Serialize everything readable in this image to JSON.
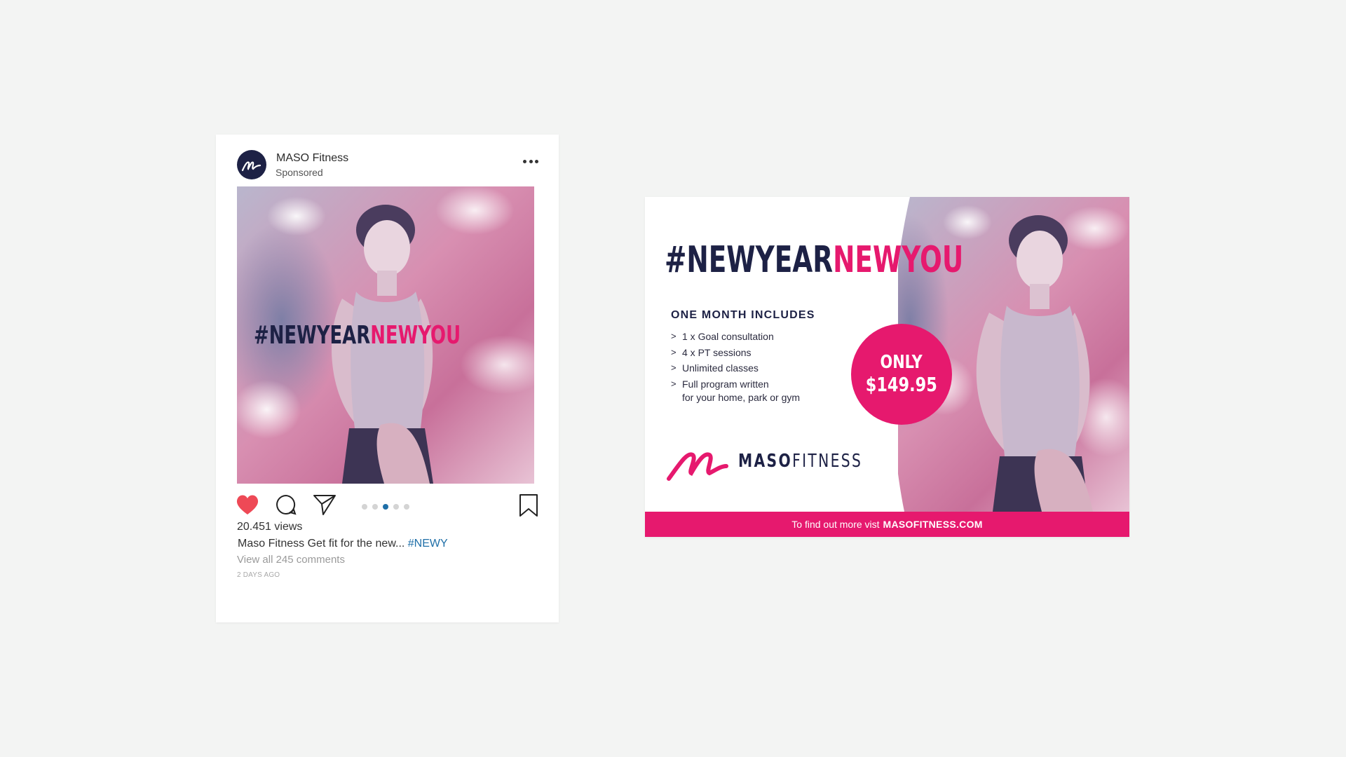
{
  "colors": {
    "background": "#f3f4f3",
    "navy": "#1d2145",
    "pink": "#e6196e",
    "link_blue": "#1f6fa8",
    "heart_red": "#ee4956"
  },
  "post": {
    "account_name": "MASO Fitness",
    "sponsored": "Sponsored",
    "more_icon": "ellipsis-icon",
    "hashtag_dark": "#NEWYEAR",
    "hashtag_pink": "NEWYOU",
    "actions": [
      "heart-icon",
      "comment-icon",
      "share-icon",
      "bookmark-icon"
    ],
    "carousel": {
      "count": 5,
      "active_index": 2
    },
    "views": "20.451 views",
    "caption_user": "Maso Fitness",
    "caption_text": "Get fit for the new...",
    "caption_tag": "#NEWY",
    "comments_link": "View all 245 comments",
    "time": "2 DAYS AGO"
  },
  "ad": {
    "hashtag_dark": "#NEWYEAR",
    "hashtag_pink": "NEWYOU",
    "includes_title": "ONE MONTH INCLUDES",
    "includes": [
      "1 x Goal consultation",
      "4 x PT sessions",
      "Unlimited classes",
      "Full program written"
    ],
    "includes_sub": "for your home, park or gym",
    "price_only": "ONLY",
    "price": "$149.95",
    "brand_bold": "MASO",
    "brand_light": "FITNESS",
    "footer_text": "To find out more vist",
    "footer_url": "MASOFITNESS.COM"
  }
}
